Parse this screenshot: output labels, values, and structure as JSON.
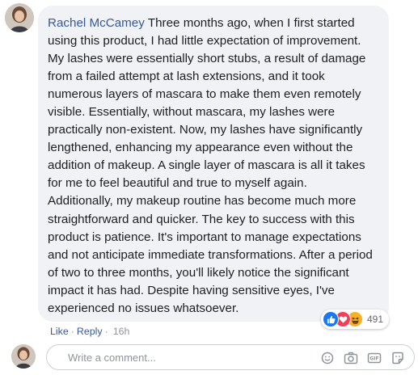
{
  "comment": {
    "author": "Rachel McCamey",
    "text": "Three months ago, when I first started using this product, I had little expectation of improvement. My lashes were essentially short stubs, a result of damage from a failed attempt at lash extensions, and it took numerous layers of mascara to make them even remotely visible. Essentially, without mascara, my lashes were practically non-existent. Now, my lashes have significantly lengthened, enhancing my appearance even without the addition of makeup. A single layer of mascara is all it takes for me to feel beautiful and true to myself again. Additionally, my makeup routine has become much more straightforward and quicker. The key to success with this product is patience. It's important to manage expectations and not anticipate immediate transformations. After a period of two to three months, you'll likely notice the significant impact it has had. Despite having sensitive eyes, I've experienced no issues whatsoever.",
    "reactions": {
      "icons": [
        "like-icon",
        "love-icon",
        "haha-icon"
      ],
      "count": "491"
    },
    "actions": {
      "like_label": "Like",
      "reply_label": "Reply",
      "separator": "·",
      "time": "16h"
    }
  },
  "composer": {
    "placeholder": "Write a comment...",
    "icons": [
      "emoji-icon",
      "camera-icon",
      "gif-icon",
      "sticker-icon"
    ]
  },
  "colors": {
    "author_link": "#385898",
    "bubble_bg": "#f0f2f5",
    "like_blue": "#1877f2",
    "love_red": "#f33e58",
    "haha_yellow": "#f7b125"
  }
}
